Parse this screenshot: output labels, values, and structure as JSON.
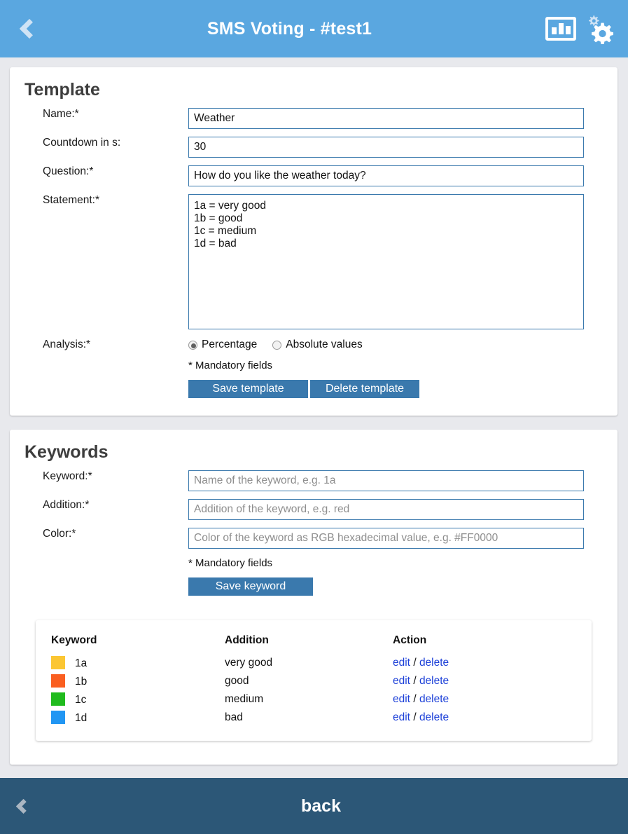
{
  "header": {
    "title": "SMS Voting - #test1",
    "back_icon": "chevron-left-icon",
    "chart_icon": "bar-chart-icon",
    "settings_icon": "gears-icon"
  },
  "template_section": {
    "title": "Template",
    "fields": {
      "name": {
        "label": "Name:*",
        "value": "Weather"
      },
      "countdown": {
        "label": "Countdown in s:",
        "value": "30"
      },
      "question": {
        "label": "Question:*",
        "value": "How do you like the weather today?"
      },
      "statement": {
        "label": "Statement:*",
        "value": "1a = very good\n1b = good\n1c = medium\n1d = bad"
      }
    },
    "analysis": {
      "label": "Analysis:*",
      "options": [
        {
          "label": "Percentage",
          "selected": true
        },
        {
          "label": "Absolute values",
          "selected": false
        }
      ]
    },
    "mandatory_note": "* Mandatory fields",
    "save_label": "Save template",
    "delete_label": "Delete template"
  },
  "keywords_section": {
    "title": "Keywords",
    "fields": {
      "keyword": {
        "label": "Keyword:*",
        "value": "",
        "placeholder": "Name of the keyword, e.g. 1a"
      },
      "addition": {
        "label": "Addition:*",
        "value": "",
        "placeholder": "Addition of the keyword, e.g. red"
      },
      "color": {
        "label": "Color:*",
        "value": "",
        "placeholder": "Color of the keyword as RGB hexadecimal value, e.g. #FF0000"
      }
    },
    "mandatory_note": "* Mandatory fields",
    "save_label": "Save keyword",
    "table": {
      "columns": [
        "Keyword",
        "Addition",
        "Action"
      ],
      "rows": [
        {
          "color": "#FBC633",
          "keyword": "1a",
          "addition": "very good",
          "edit": "edit",
          "sep": "/",
          "delete": "delete"
        },
        {
          "color": "#FA5F21",
          "keyword": "1b",
          "addition": "good",
          "edit": "edit",
          "sep": "/",
          "delete": "delete"
        },
        {
          "color": "#20BB1E",
          "keyword": "1c",
          "addition": "medium",
          "edit": "edit",
          "sep": "/",
          "delete": "delete"
        },
        {
          "color": "#2196F3",
          "keyword": "1d",
          "addition": "bad",
          "edit": "edit",
          "sep": "/",
          "delete": "delete"
        }
      ]
    }
  },
  "footer": {
    "label": "back",
    "back_icon": "chevron-left-icon"
  },
  "colors": {
    "appbar": "#5aa7e0",
    "footer": "#2c5777",
    "button": "#3a79ad",
    "link": "#1b3fd8",
    "page_bg": "#e8e9ed"
  }
}
